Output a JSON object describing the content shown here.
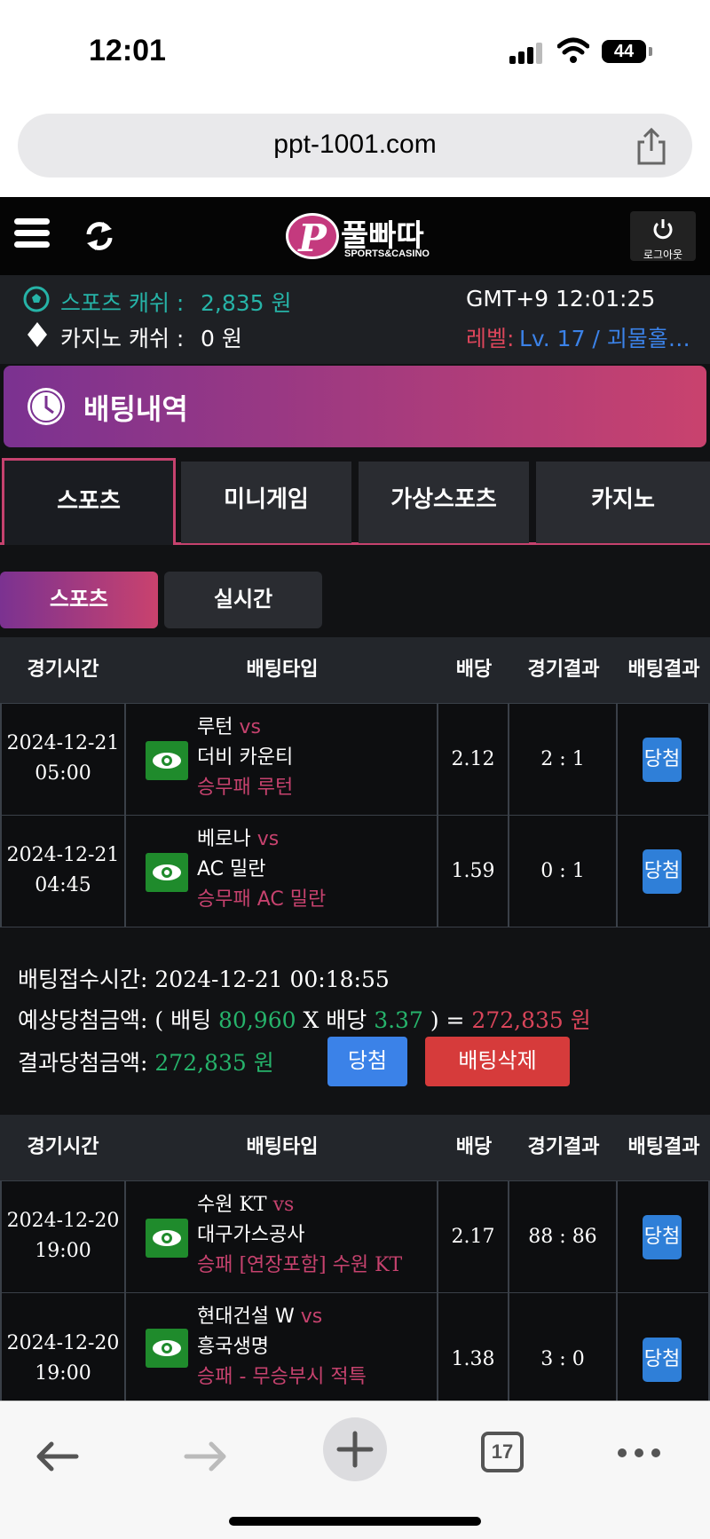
{
  "status": {
    "time": "12:01",
    "battery": "44"
  },
  "browser": {
    "url": "ppt-1001.com",
    "tab_count": "17"
  },
  "header": {
    "logo_main": "풀빠따",
    "logo_sub": "SPORTS&CASINO",
    "logout_label": "로그아웃"
  },
  "info": {
    "sports_cash_label": "스포츠 캐쉬 :",
    "sports_cash_value": "2,835 원",
    "casino_cash_label": "카지노 캐쉬 :",
    "casino_cash_value": "0 원",
    "clock": "GMT+9 12:01:25",
    "level_label": "레벨:",
    "level_value": "Lv. 17 / 괴물홀…"
  },
  "page_title": "배팅내역",
  "tabs": [
    "스포츠",
    "미니게임",
    "가상스포츠",
    "카지노"
  ],
  "subtabs": [
    "스포츠",
    "실시간"
  ],
  "table_headers": [
    "경기시간",
    "배팅타입",
    "배당",
    "경기결과",
    "배팅결과"
  ],
  "slip1": {
    "rows": [
      {
        "date": "2024-12-21",
        "time": "05:00",
        "home": "루턴",
        "vs": "vs",
        "away": "더비 카운티",
        "pick": "승무패 루턴",
        "odds": "2.12",
        "score": "2 : 1",
        "result": "당첨"
      },
      {
        "date": "2024-12-21",
        "time": "04:45",
        "home": "베로나",
        "vs": "vs",
        "away": "AC 밀란",
        "pick": "승무패 AC 밀란",
        "odds": "1.59",
        "score": "0 : 1",
        "result": "당첨"
      }
    ],
    "summary": {
      "received_label": "배팅접수시간:",
      "received_value": "2024-12-21 00:18:55",
      "expected_label": "예상당첨금액:",
      "open_paren": "( 배팅",
      "stake": "80,960",
      "x_odds": "X 배당",
      "total_odds": "3.37",
      "close_eq": ") =",
      "expected_value": "272,835 원",
      "result_label": "결과당첨금액:",
      "result_value": "272,835 원",
      "win_button": "당첨",
      "delete_button": "배팅삭제"
    }
  },
  "slip2": {
    "rows": [
      {
        "date": "2024-12-20",
        "time": "19:00",
        "home": "수원 KT",
        "vs": "vs",
        "away": "대구가스공사",
        "pick": "승패 [연장포함] 수원 KT",
        "odds": "2.17",
        "score": "88 : 86",
        "result": "당첨"
      },
      {
        "date": "2024-12-20",
        "time": "19:00",
        "home": "현대건설 W",
        "vs": "vs",
        "away": "흥국생명",
        "pick": "승패 - 무승부시 적특",
        "odds": "1.38",
        "score": "3 : 0",
        "result": "당첨"
      }
    ]
  },
  "colors": {
    "accent_pink": "#c6426e",
    "accent_purple": "#7b3291",
    "teal": "#26b3a7",
    "win_blue": "#2f7fd8",
    "delete_red": "#d63b3b"
  }
}
